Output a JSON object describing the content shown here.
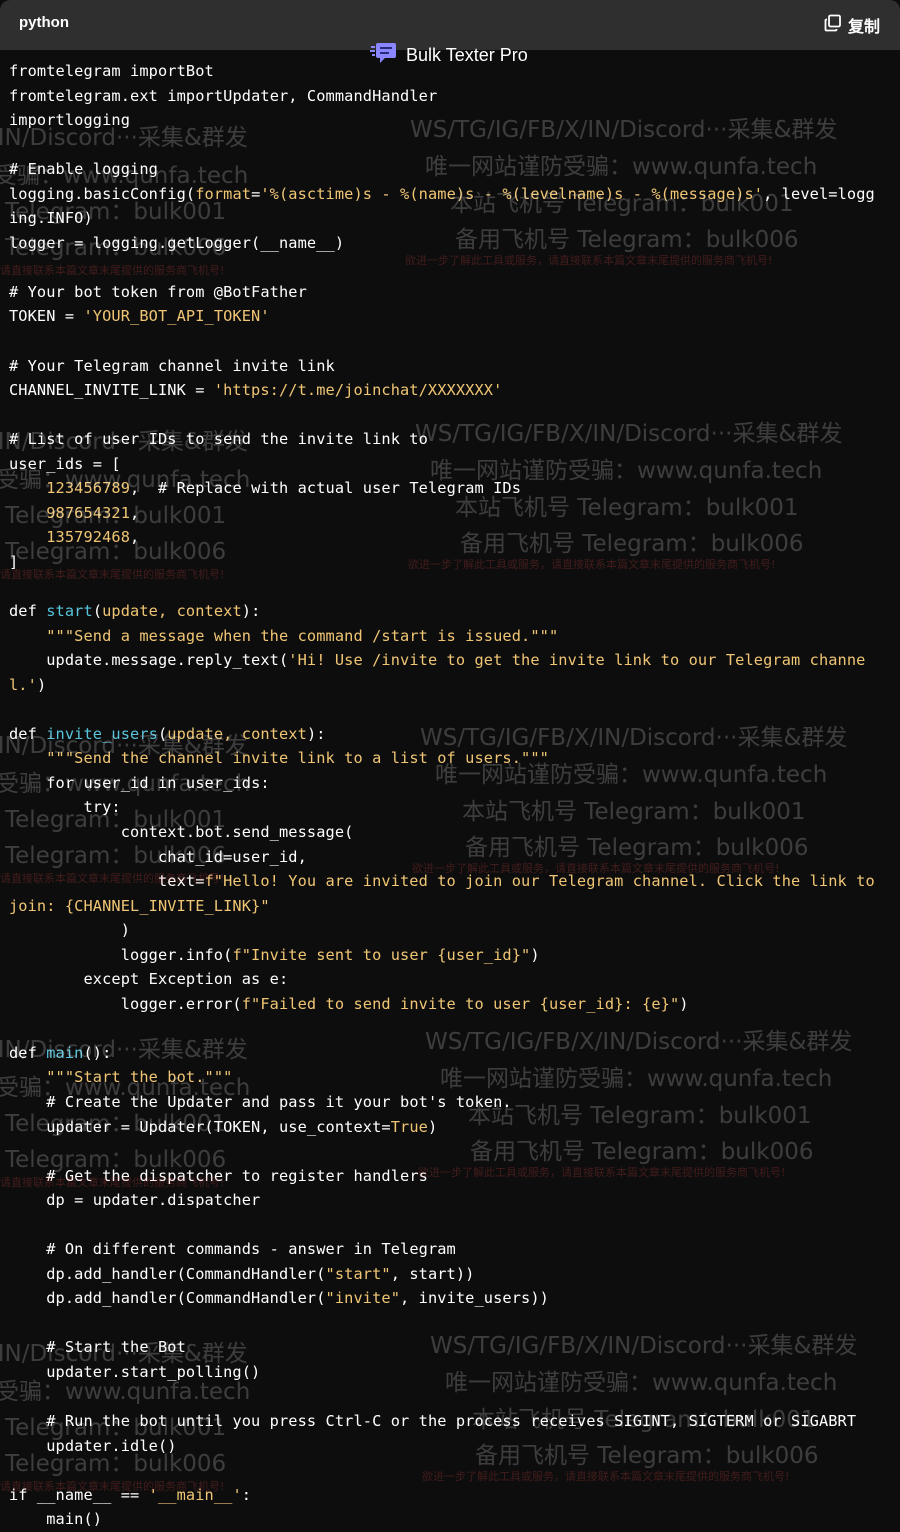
{
  "header": {
    "language": "python",
    "copy_label": "复制",
    "brand": "Bulk Texter Pro"
  },
  "code": [
    [
      [
        "kw",
        "from"
      ],
      [
        "",
        "telegram "
      ],
      [
        "kw",
        "import"
      ],
      [
        "",
        "Bot"
      ]
    ],
    [
      [
        "kw",
        "from"
      ],
      [
        "",
        "telegram.ext "
      ],
      [
        "kw",
        "import"
      ],
      [
        "",
        "Updater, CommandHandler"
      ]
    ],
    [
      [
        "kw",
        "import"
      ],
      [
        "",
        "logging"
      ]
    ],
    [],
    [
      [
        "cmt",
        "# Enable logging"
      ]
    ],
    [
      [
        "",
        "logging.basicConfig("
      ],
      [
        "param",
        "format"
      ],
      [
        "",
        "="
      ],
      [
        "str",
        "'%(asctime)s - %(name)s - %(levelname)s - %(message)s'"
      ],
      [
        "",
        ", level=logg"
      ]
    ],
    [
      [
        "",
        "ing.INFO)"
      ]
    ],
    [
      [
        "",
        "logger = logging.getLogger(__name__)"
      ]
    ],
    [],
    [
      [
        "cmt",
        "# Your bot token from @BotFather"
      ]
    ],
    [
      [
        "",
        "TOKEN = "
      ],
      [
        "str",
        "'YOUR_BOT_API_TOKEN'"
      ]
    ],
    [],
    [
      [
        "cmt",
        "# Your Telegram channel invite link"
      ]
    ],
    [
      [
        "",
        "CHANNEL_INVITE_LINK = "
      ],
      [
        "str",
        "'https://t.me/joinchat/XXXXXXX'"
      ]
    ],
    [],
    [
      [
        "cmt",
        "# List of user IDs to send the invite link to"
      ]
    ],
    [
      [
        "",
        "user_ids = ["
      ]
    ],
    [
      [
        "",
        "    "
      ],
      [
        "num",
        "123456789"
      ],
      [
        "",
        ",  # Replace with actual user Telegram IDs"
      ]
    ],
    [
      [
        "",
        "    "
      ],
      [
        "num",
        "987654321"
      ],
      [
        "",
        ","
      ]
    ],
    [
      [
        "",
        "    "
      ],
      [
        "num",
        "135792468"
      ],
      [
        "",
        ","
      ]
    ],
    [
      [
        "",
        "]"
      ]
    ],
    [],
    [
      [
        "kw",
        "def"
      ],
      [
        "",
        " "
      ],
      [
        "fn",
        "start"
      ],
      [
        "",
        "("
      ],
      [
        "param",
        "update, context"
      ],
      [
        "",
        "):"
      ]
    ],
    [
      [
        "",
        "    "
      ],
      [
        "str",
        "\"\"\"Send a message when the command /start is issued.\"\"\""
      ]
    ],
    [
      [
        "",
        "    update.message.reply_text("
      ],
      [
        "str",
        "'Hi! Use /invite to get the invite link to our Telegram channe"
      ]
    ],
    [
      [
        "str",
        "l.'"
      ],
      [
        "",
        ")"
      ]
    ],
    [],
    [
      [
        "kw",
        "def"
      ],
      [
        "",
        " "
      ],
      [
        "fn",
        "invite_users"
      ],
      [
        "",
        "("
      ],
      [
        "param",
        "update, context"
      ],
      [
        "",
        "):"
      ]
    ],
    [
      [
        "",
        "    "
      ],
      [
        "str",
        "\"\"\"Send the channel invite link to a list of users.\"\"\""
      ]
    ],
    [
      [
        "",
        "    "
      ],
      [
        "kw",
        "for"
      ],
      [
        "",
        " user_id "
      ],
      [
        "kw",
        "in"
      ],
      [
        "",
        " user_ids:"
      ]
    ],
    [
      [
        "",
        "        "
      ],
      [
        "kw",
        "try"
      ],
      [
        "",
        ":"
      ]
    ],
    [
      [
        "",
        "            context.bot.send_message("
      ]
    ],
    [
      [
        "",
        "                chat_id=user_id,"
      ]
    ],
    [
      [
        "",
        "                text="
      ],
      [
        "str",
        "f\"Hello! You are invited to join our Telegram channel. Click the link to"
      ]
    ],
    [
      [
        "str",
        "join: {CHANNEL_INVITE_LINK}\""
      ]
    ],
    [
      [
        "",
        "            )"
      ]
    ],
    [
      [
        "",
        "            logger.info("
      ],
      [
        "str",
        "f\"Invite sent to user {user_id}\""
      ],
      [
        "",
        ")"
      ]
    ],
    [
      [
        "",
        "        "
      ],
      [
        "kw",
        "except"
      ],
      [
        "",
        " Exception "
      ],
      [
        "kw",
        "as"
      ],
      [
        "",
        " e:"
      ]
    ],
    [
      [
        "",
        "            logger.error("
      ],
      [
        "str",
        "f\"Failed to send invite to user {user_id}: {e}\""
      ],
      [
        "",
        ")"
      ]
    ],
    [],
    [
      [
        "kw",
        "def"
      ],
      [
        "",
        " "
      ],
      [
        "fn",
        "main"
      ],
      [
        "",
        "():"
      ]
    ],
    [
      [
        "",
        "    "
      ],
      [
        "str",
        "\"\"\"Start the bot.\"\"\""
      ]
    ],
    [
      [
        "",
        "    "
      ],
      [
        "cmt",
        "# Create the Updater and pass it your bot's token."
      ]
    ],
    [
      [
        "",
        "    updater = Updater(TOKEN, use_context="
      ],
      [
        "str",
        "True"
      ],
      [
        "",
        ")"
      ]
    ],
    [],
    [
      [
        "",
        "    "
      ],
      [
        "cmt",
        "# Get the dispatcher to register handlers"
      ]
    ],
    [
      [
        "",
        "    dp = updater.dispatcher"
      ]
    ],
    [],
    [
      [
        "",
        "    "
      ],
      [
        "cmt",
        "# On different commands - answer in Telegram"
      ]
    ],
    [
      [
        "",
        "    dp.add_handler(CommandHandler("
      ],
      [
        "str",
        "\"start\""
      ],
      [
        "",
        ", start))"
      ]
    ],
    [
      [
        "",
        "    dp.add_handler(CommandHandler("
      ],
      [
        "str",
        "\"invite\""
      ],
      [
        "",
        ", invite_users))"
      ]
    ],
    [],
    [
      [
        "",
        "    "
      ],
      [
        "cmt",
        "# Start the Bot"
      ]
    ],
    [
      [
        "",
        "    updater.start_polling()"
      ]
    ],
    [],
    [
      [
        "",
        "    "
      ],
      [
        "cmt",
        "# Run the bot until you press Ctrl-C or the process receives SIGINT, SIGTERM or SIGABRT"
      ]
    ],
    [
      [
        "",
        "    updater.idle()"
      ]
    ],
    [],
    [
      [
        "kw",
        "if"
      ],
      [
        "",
        " __name__ == "
      ],
      [
        "str",
        "'__main__'"
      ],
      [
        "",
        ":"
      ]
    ],
    [
      [
        "",
        "    main()"
      ]
    ]
  ],
  "watermark": {
    "line1": "WS/TG/IG/FB/X/IN/Discord···采集&群发",
    "line2": "唯一网站谨防受骗：www.qunfa.tech",
    "line3": "本站飞机号 Telegram：bulk001",
    "line4": "备用飞机号 Telegram：bulk006",
    "line5": "欲进一步了解此工具或服务，请直接联系本篇文章末尾提供的服务商飞机号!",
    "left1": "/IN/Discord···采集&群发",
    "left2": "受骗：www.qunfa.tech",
    "left3": "Telegram：bulk001",
    "left4": "Telegram：bulk006",
    "left5": "请直接联系本篇文章末尾提供的服务商飞机号!"
  },
  "colors": {
    "background": "#0d0d0d",
    "header": "#2f2f2f",
    "function_name": "#58c4dc",
    "string": "#f0c674",
    "text": "#ffffff"
  }
}
